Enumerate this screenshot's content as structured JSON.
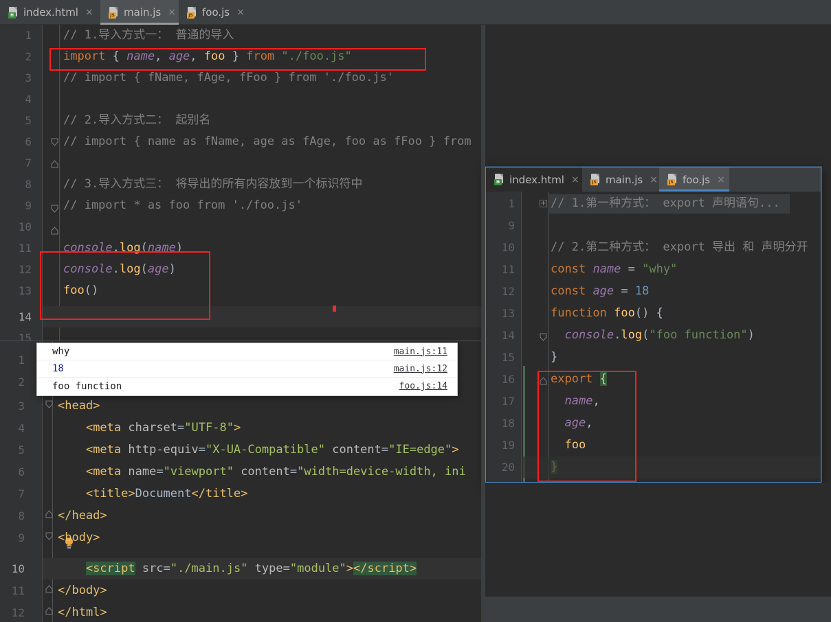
{
  "window": {
    "theme": "Darcula",
    "bg": "#2b2b2b",
    "chrome_bg": "#3c3f41",
    "accent": "#4a88c7",
    "annotation_color": "#ff1f1f"
  },
  "main_tabbar": {
    "tabs": [
      {
        "label": "index.html",
        "icon": "html-file-icon",
        "badge": "H",
        "active": false,
        "close": "×"
      },
      {
        "label": "main.js",
        "icon": "js-file-icon",
        "badge": "JS",
        "active": true,
        "close": "×"
      },
      {
        "label": "foo.js",
        "icon": "js-file-icon",
        "badge": "JS",
        "active": false,
        "close": "×"
      }
    ]
  },
  "main_editor": {
    "file": "main.js",
    "current_line": 14,
    "lines": [
      {
        "n": "1",
        "text": "// 1.导入方式一： 普通的导入"
      },
      {
        "n": "2",
        "text": "import { name, age, foo } from \"./foo.js\""
      },
      {
        "n": "3",
        "text": "// import { fName, fAge, fFoo } from './foo.js'"
      },
      {
        "n": "4",
        "text": ""
      },
      {
        "n": "5",
        "text": "// 2.导入方式二： 起别名"
      },
      {
        "n": "6",
        "text": "// import { name as fName, age as fAge, foo as fFoo } from './foo.js'"
      },
      {
        "n": "7",
        "text": ""
      },
      {
        "n": "8",
        "text": "// 3.导入方式三： 将导出的所有内容放到一个标识符中"
      },
      {
        "n": "9",
        "text": "// import * as foo from './foo.js'"
      },
      {
        "n": "10",
        "text": ""
      },
      {
        "n": "11",
        "text": "console.log(name)"
      },
      {
        "n": "12",
        "text": "console.log(age)"
      },
      {
        "n": "13",
        "text": "foo()"
      },
      {
        "n": "14",
        "text": ""
      },
      {
        "n": "15",
        "text": ""
      }
    ]
  },
  "console_panel": {
    "rows": [
      {
        "message": "why",
        "source": "main.js:11",
        "kind": "string"
      },
      {
        "message": "18",
        "source": "main.js:12",
        "kind": "number"
      },
      {
        "message": "foo function",
        "source": "foo.js:14",
        "kind": "string"
      }
    ]
  },
  "html_editor": {
    "file": "index.html",
    "current_line": "10",
    "lines": [
      {
        "n": "1",
        "text": ""
      },
      {
        "n": "2",
        "text": ""
      },
      {
        "n": "3",
        "text": "<head>"
      },
      {
        "n": "4",
        "text": "    <meta charset=\"UTF-8\">"
      },
      {
        "n": "5",
        "text": "    <meta http-equiv=\"X-UA-Compatible\" content=\"IE=edge\">"
      },
      {
        "n": "6",
        "text": "    <meta name=\"viewport\" content=\"width=device-width, ini"
      },
      {
        "n": "7",
        "text": "    <title>Document</title>"
      },
      {
        "n": "8",
        "text": "</head>"
      },
      {
        "n": "9",
        "text": "<body>"
      },
      {
        "n": "10",
        "text": "    <script src=\"./main.js\" type=\"module\"></script>"
      },
      {
        "n": "11",
        "text": "</body>"
      },
      {
        "n": "12",
        "text": "</html>"
      }
    ]
  },
  "float_window": {
    "tabbar": {
      "tabs": [
        {
          "label": "index.html",
          "icon": "html-file-icon",
          "badge": "H",
          "active": false,
          "close": "×"
        },
        {
          "label": "main.js",
          "icon": "js-file-icon",
          "badge": "JS",
          "active": false,
          "close": "×"
        },
        {
          "label": "foo.js",
          "icon": "js-file-icon",
          "badge": "JS",
          "active": true,
          "close": "×"
        }
      ]
    },
    "editor": {
      "file": "foo.js",
      "lines": [
        {
          "n": "1",
          "text": "// 1.第一种方式： export 声明语句...",
          "folded": true
        },
        {
          "n": "9",
          "text": ""
        },
        {
          "n": "10",
          "text": "// 2.第二种方式： export 导出 和 声明分开"
        },
        {
          "n": "11",
          "text": "const name = \"why\""
        },
        {
          "n": "12",
          "text": "const age = 18"
        },
        {
          "n": "13",
          "text": "function foo() {"
        },
        {
          "n": "14",
          "text": "  console.log(\"foo function\")"
        },
        {
          "n": "15",
          "text": "}"
        },
        {
          "n": "16",
          "text": "export {"
        },
        {
          "n": "17",
          "text": "  name,"
        },
        {
          "n": "18",
          "text": "  age,"
        },
        {
          "n": "19",
          "text": "  foo"
        },
        {
          "n": "20",
          "text": "}"
        }
      ]
    }
  },
  "annotations": [
    {
      "name": "import-statement-highlight",
      "target": "main.js line 2"
    },
    {
      "name": "console-log-block-highlight",
      "target": "main.js lines 11-13"
    },
    {
      "name": "export-block-highlight",
      "target": "foo.js lines 16-20"
    }
  ]
}
